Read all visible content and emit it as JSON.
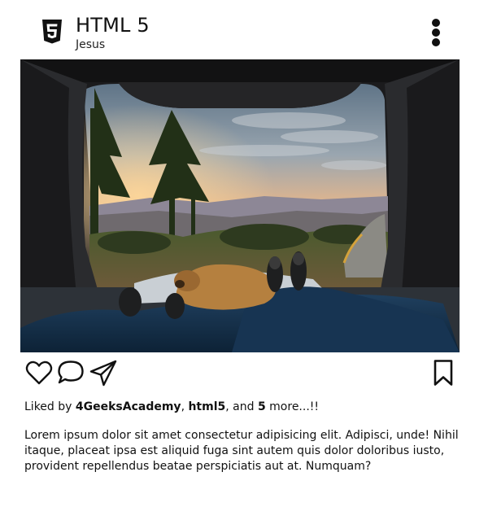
{
  "header": {
    "title": "HTML 5",
    "subtitle": "Jesus",
    "logo_icon": "html5-logo-icon",
    "menu_icon": "more-vertical-icon"
  },
  "post": {
    "image_icon": "camping-car-trunk-photo"
  },
  "actions": {
    "like_icon": "heart-icon",
    "comment_icon": "comment-icon",
    "share_icon": "send-icon",
    "save_icon": "bookmark-icon"
  },
  "likes": {
    "prefix": "Liked by ",
    "user1": "4GeeksAcademy",
    "sep1": ", ",
    "user2": "html5",
    "sep2": ", and ",
    "count": "5",
    "suffix": " more...!!"
  },
  "description": "Lorem ipsum dolor sit amet consectetur adipisicing elit. Adipisci, unde! Nihil itaque, placeat ipsa est aliquid fuga sint autem quis dolor doloribus iusto, provident repellendus beatae perspiciatis aut at. Numquam?",
  "colors": {
    "text": "#111111",
    "background": "#ffffff"
  }
}
